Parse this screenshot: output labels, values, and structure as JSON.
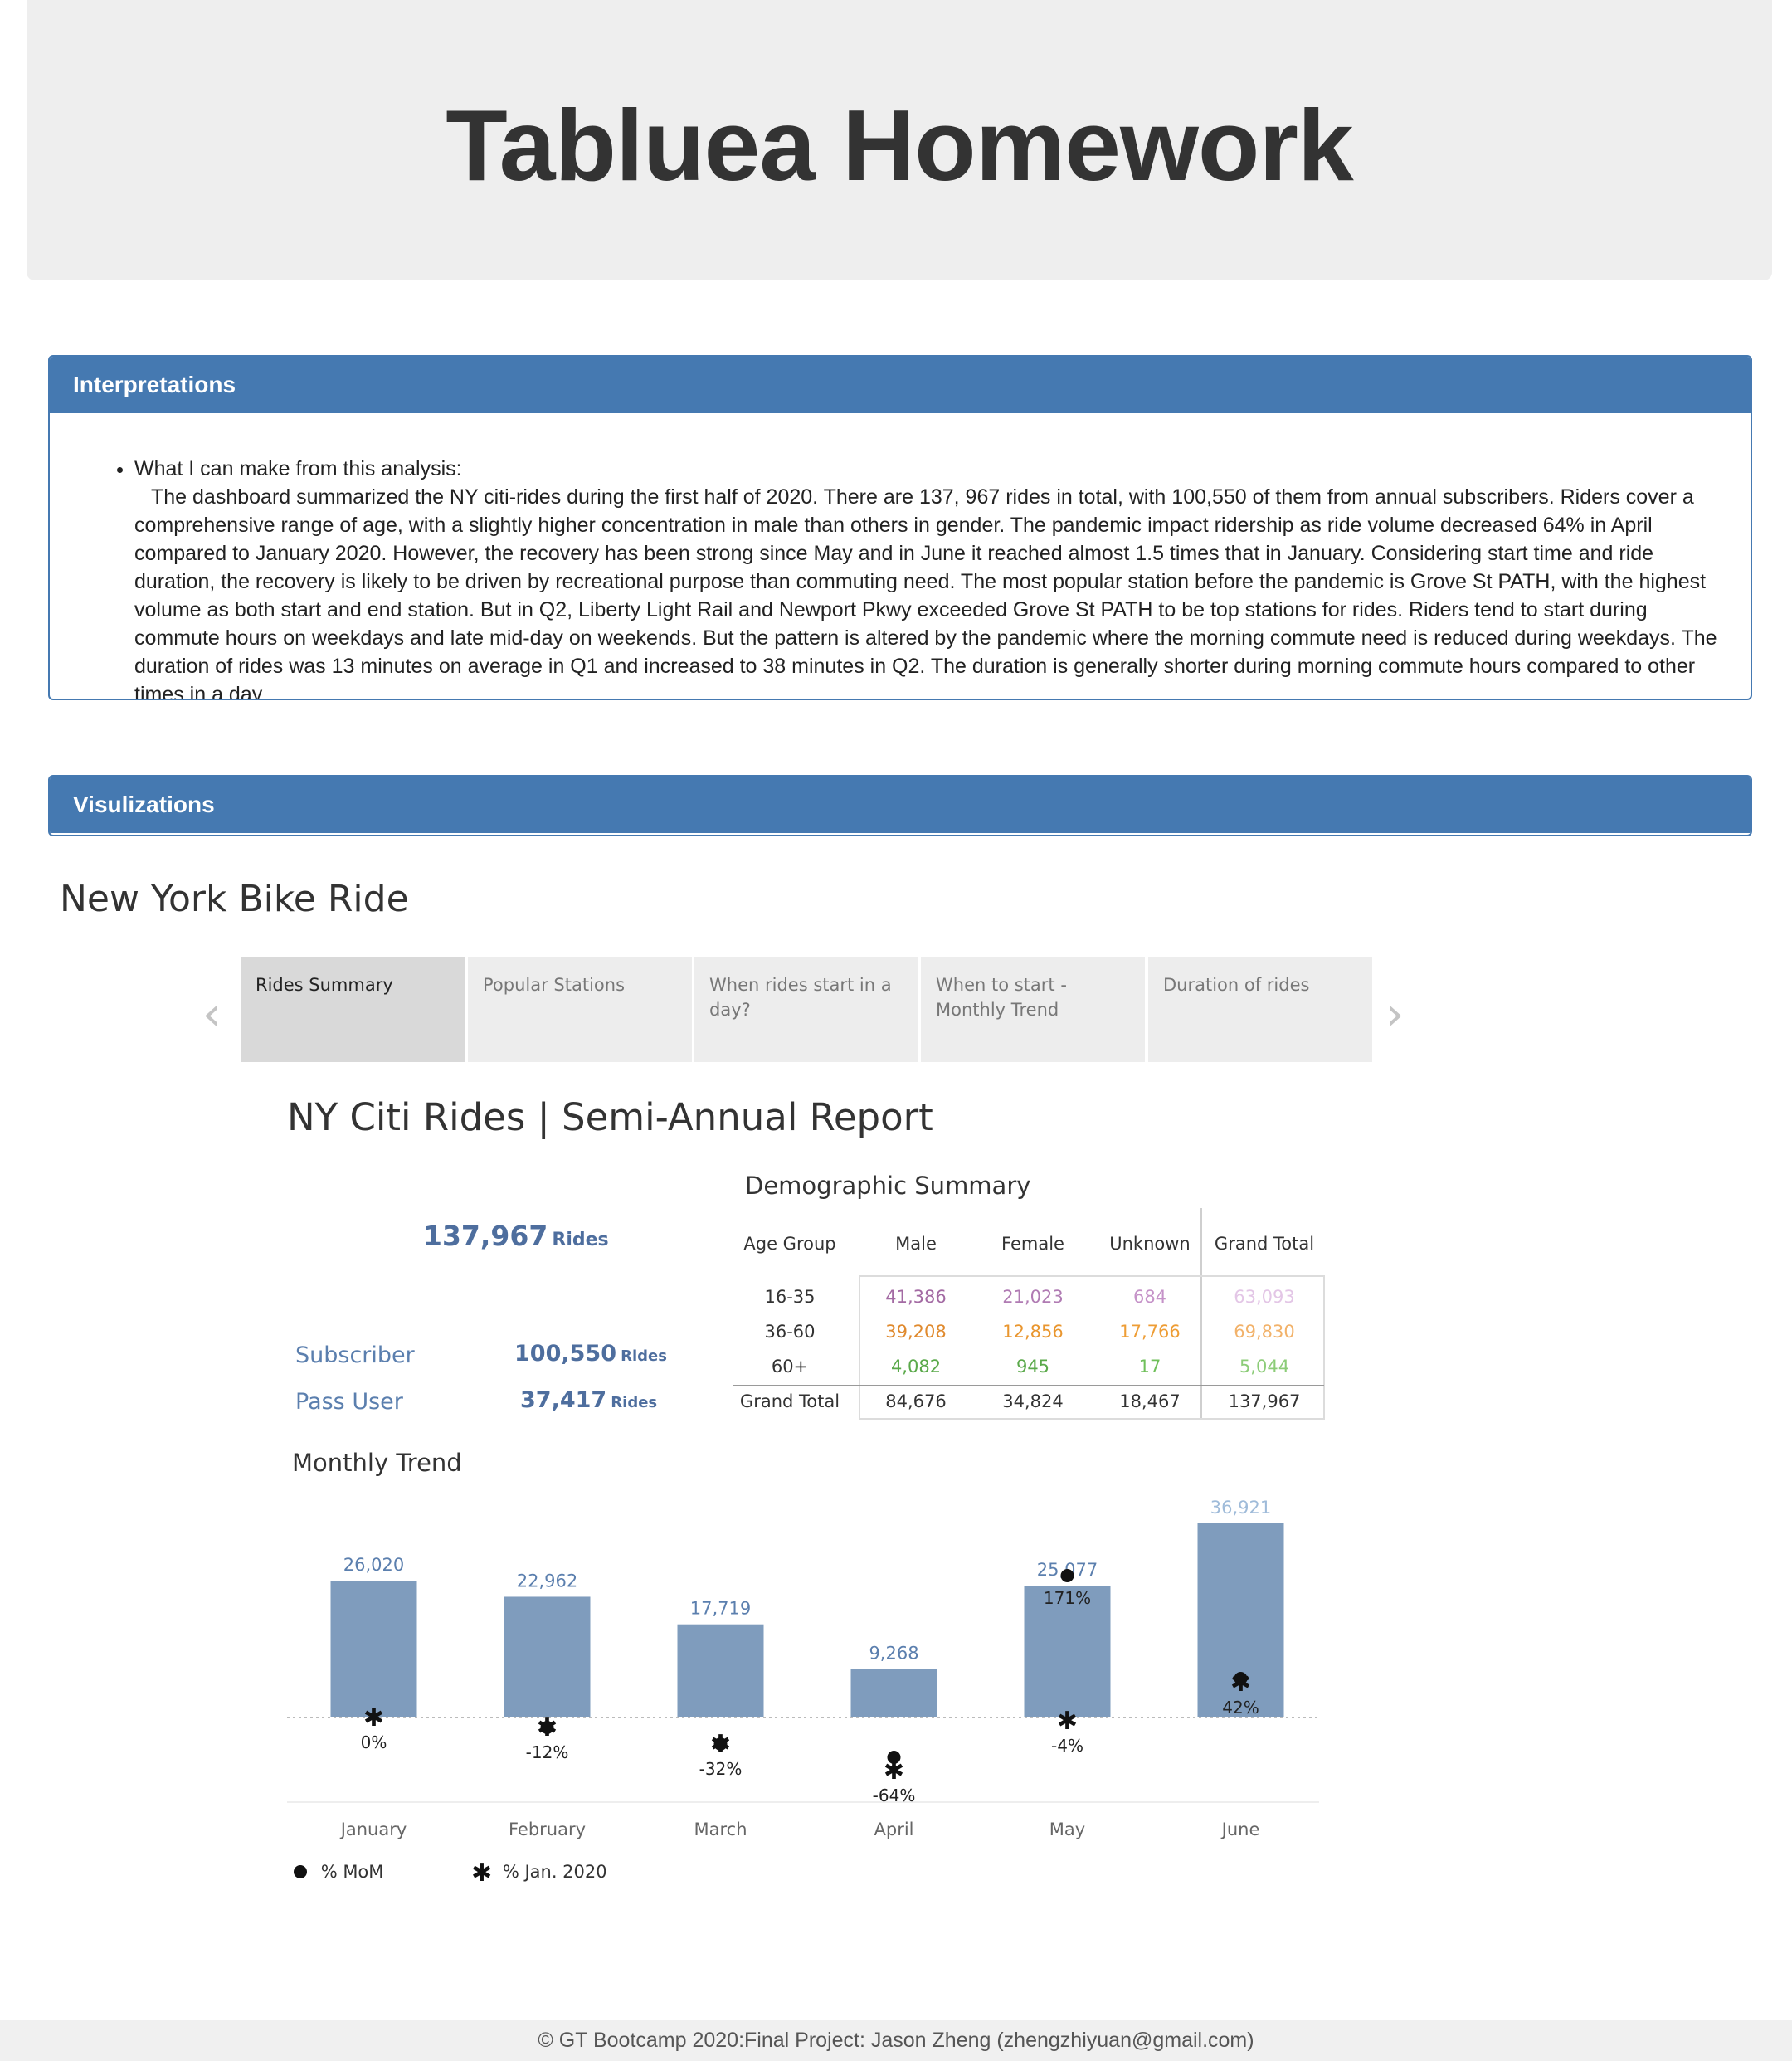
{
  "header": {
    "title": "Tabluea Homework"
  },
  "interpretations": {
    "heading": "Interpretations",
    "bullet_title": "What I can make from this analysis:",
    "text": "The dashboard summarized the NY citi-rides during the first half of 2020. There are 137, 967 rides in total, with 100,550 of them from annual subscribers. Riders cover a comprehensive range of age, with a slightly higher concentration in male than others in gender. The pandemic impact ridership as ride volume decreased 64% in April compared to January 2020. However, the recovery has been strong since May and in June it reached almost 1.5 times that in January. Considering start time and ride duration, the recovery is likely to be driven by recreational purpose than commuting need. The most popular station before the pandemic is Grove St PATH, with the highest volume as both start and end station. But in Q2, Liberty Light Rail and Newport Pkwy exceeded Grove St PATH to be top stations for rides. Riders tend to start during commute hours on weekdays and late mid-day on weekends. But the pattern is altered by the pandemic where the morning commute need is reduced during weekdays. The duration of rides was 13 minutes on average in Q1 and increased to 38 minutes in Q2. The duration is generally shorter during morning commute hours compared to other times in a day."
  },
  "visualizations": {
    "heading": "Visulizations",
    "story_title": "New York Bike Ride",
    "tabs": [
      "Rides Summary",
      "Popular Stations",
      "When rides start in a day?",
      "When to start - Monthly Trend",
      "Duration of rides"
    ],
    "active_tab": 0,
    "prev_arrow": "‹",
    "next_arrow": "›"
  },
  "dashboard": {
    "title": "NY Citi Rides | Semi-Annual Report",
    "total_value": "137,967",
    "total_unit": "Rides",
    "subscriber_label": "Subscriber",
    "subscriber_value": "100,550",
    "subscriber_unit": "Rides",
    "pass_label": "Pass User",
    "pass_value": "37,417",
    "pass_unit": "Rides",
    "demo_title": "Demographic Summary",
    "demo_headers": [
      "Age Group",
      "Male",
      "Female",
      "Unknown",
      "Grand Total"
    ],
    "demo_rows": [
      {
        "label": "16-35",
        "cells": [
          "41,386",
          "21,023",
          "684",
          "63,093"
        ],
        "color": "#b57eb5"
      },
      {
        "label": "36-60",
        "cells": [
          "39,208",
          "12,856",
          "17,766",
          "69,830"
        ],
        "color": "#f0a04b"
      },
      {
        "label": "60+",
        "cells": [
          "4,082",
          "945",
          "17",
          "5,044"
        ],
        "color": "#6fbf5a"
      }
    ],
    "demo_total": {
      "label": "Grand Total",
      "cells": [
        "84,676",
        "34,824",
        "18,467",
        "137,967"
      ]
    },
    "trend_title": "Monthly Trend",
    "legend_mom": "% MoM",
    "legend_jan": "% Jan. 2020"
  },
  "chart_data": {
    "type": "bar",
    "title": "Monthly Trend",
    "categories": [
      "January",
      "February",
      "March",
      "April",
      "May",
      "June"
    ],
    "values": [
      26020,
      22962,
      17719,
      9268,
      25077,
      36921
    ],
    "value_labels": [
      "26,020",
      "22,962",
      "17,719",
      "9,268",
      "25,077",
      "36,921"
    ],
    "mom_pct": [
      0,
      -12,
      -32,
      -48,
      171,
      47
    ],
    "jan_pct": [
      0,
      -12,
      -32,
      -64,
      -4,
      42
    ],
    "jan_pct_labels": [
      "0%",
      "-12%",
      "-32%",
      "-64%",
      "-4%",
      "42%"
    ],
    "mom_highlight_label": "171%",
    "bar_color": "#7f9cbd",
    "legend": [
      "% MoM",
      "% Jan. 2020"
    ]
  },
  "footer": {
    "text": "© GT Bootcamp 2020:Final Project: Jason Zheng (zhengzhiyuan@gmail.com)"
  },
  "colors": {
    "panel_blue": "#4579b1",
    "value_blue": "#4e6e9e",
    "label_blue": "#5b7fae"
  }
}
